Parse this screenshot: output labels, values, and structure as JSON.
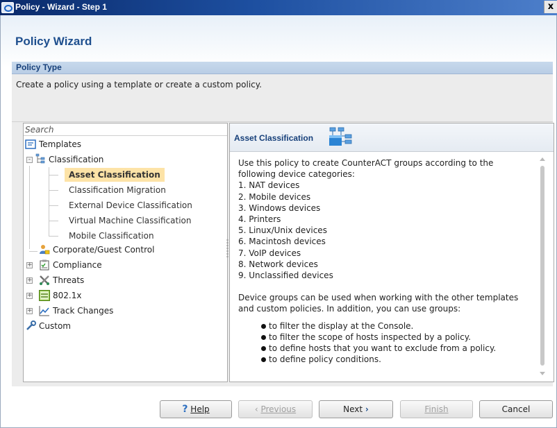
{
  "window": {
    "title": "Policy - Wizard - Step 1",
    "close_label": "x"
  },
  "wizard": {
    "heading": "Policy Wizard",
    "section_title": "Policy Type",
    "section_description": "Create a policy using a template or create a custom policy."
  },
  "tree": {
    "search_placeholder": "Search",
    "templates": "Templates",
    "classification": "Classification",
    "children": [
      "Asset Classification",
      "Classification Migration",
      "External Device Classification",
      "Virtual Machine Classification",
      "Mobile Classification"
    ],
    "corporate_guest": "Corporate/Guest Control",
    "compliance": "Compliance",
    "threats": "Threats",
    "dot1x": "802.1x",
    "track_changes": "Track Changes",
    "custom": "Custom"
  },
  "detail": {
    "title": "Asset Classification",
    "intro": "Use this policy to create CounterACT groups according to the following device categories:",
    "categories": [
      "1. NAT devices",
      "2. Mobile devices",
      "3. Windows devices",
      "4. Printers",
      "5. Linux/Unix devices",
      "6. Macintosh devices",
      "7. VoIP devices",
      "8. Network devices",
      "9. Unclassified devices"
    ],
    "groups_text": "Device groups can be used when working with the other templates and custom policies. In addition, you can use groups:",
    "bullets": [
      "to filter the display at the Console.",
      "to filter the scope of hosts inspected by a policy.",
      "to define hosts that you want to exclude from a policy.",
      "to define policy conditions."
    ]
  },
  "buttons": {
    "help": "Help",
    "previous": "Previous",
    "next": "Next",
    "finish": "Finish",
    "cancel": "Cancel"
  },
  "icons": {
    "app": "counteract-icon",
    "templates": "templates-icon",
    "classification": "classification-tree-icon",
    "corporate_guest": "users-icon",
    "compliance": "clipboard-icon",
    "threats": "crossed-tools-icon",
    "dot1x": "802-1x-icon",
    "track_changes": "line-chart-icon",
    "custom": "wrench-icon",
    "asset": "network-devices-icon"
  },
  "colors": {
    "title_bar": "#1d4fa0",
    "heading": "#1e4f8e",
    "selection": "#fde3a7"
  }
}
